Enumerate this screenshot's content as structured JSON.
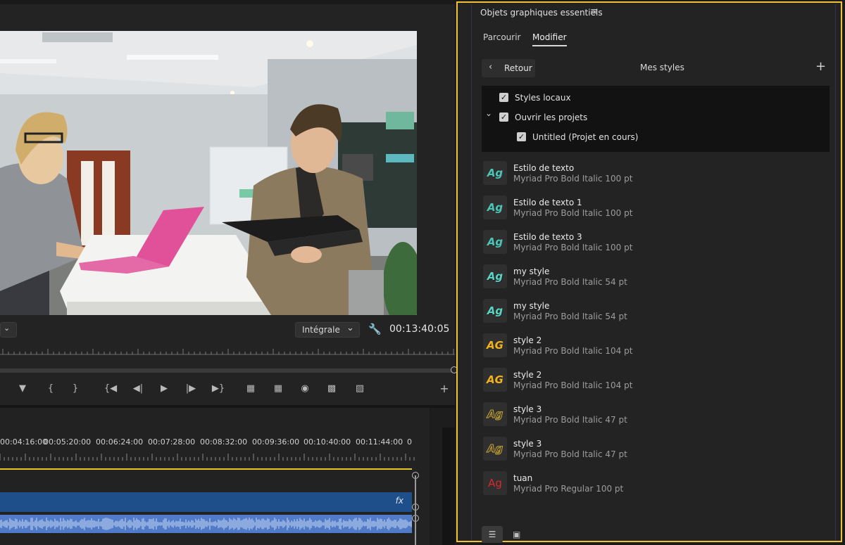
{
  "monitor": {
    "fit_dropdown": "Intégrale",
    "timecode": "00:13:40:05"
  },
  "timeline": {
    "time_labels": [
      "00:04:16:00",
      "00:05:20:00",
      "00:06:24:00",
      "00:07:28:00",
      "00:08:32:00",
      "00:09:36:00",
      "00:10:40:00",
      "00:11:44:00",
      "0"
    ],
    "fx_label": "fx"
  },
  "panel": {
    "title": "Objets graphiques essentiels",
    "tabs": [
      "Parcourir",
      "Modifier"
    ],
    "active_tab": "Modifier",
    "back_label": "Retour",
    "section_title": "Mes styles",
    "tree": [
      {
        "label": "Styles locaux",
        "checked": true
      },
      {
        "label": "Ouvrir les projets",
        "checked": true,
        "expanded": true
      },
      {
        "label": "Untitled (Projet en cours)",
        "checked": true
      }
    ],
    "styles": [
      {
        "name": "Estilo de texto",
        "desc": "Myriad Pro Bold Italic 100 pt",
        "thumb": "Ag",
        "color": "#49c6b6"
      },
      {
        "name": "Estilo de texto 1",
        "desc": "Myriad Pro Bold Italic 100 pt",
        "thumb": "Ag",
        "color": "#49c6b6"
      },
      {
        "name": "Estilo de texto 3",
        "desc": "Myriad Pro Bold Italic 100 pt",
        "thumb": "Ag",
        "color": "#49c6b6"
      },
      {
        "name": "my style",
        "desc": "Myriad Pro Bold Italic 54 pt",
        "thumb": "Ag",
        "color": "#59d3c4"
      },
      {
        "name": "my style",
        "desc": "Myriad Pro Bold Italic 54 pt",
        "thumb": "Ag",
        "color": "#59d3c4"
      },
      {
        "name": "style 2",
        "desc": "Myriad Pro Bold Italic 104 pt",
        "thumb": "AG",
        "color": "#f1b21c"
      },
      {
        "name": "style 2",
        "desc": "Myriad Pro Bold Italic 104 pt",
        "thumb": "AG",
        "color": "#f1b21c"
      },
      {
        "name": "style 3",
        "desc": "Myriad Pro Bold Italic 47 pt",
        "thumb": "Ag",
        "color": "#c9a531"
      },
      {
        "name": "style 3",
        "desc": "Myriad Pro Bold Italic 47 pt",
        "thumb": "Ag",
        "color": "#c9a531"
      },
      {
        "name": "tuan",
        "desc": "Myriad Pro Regular 100 pt",
        "thumb": "Ag",
        "color": "#d62a2a"
      }
    ],
    "highlight_color": "#f1c232"
  }
}
